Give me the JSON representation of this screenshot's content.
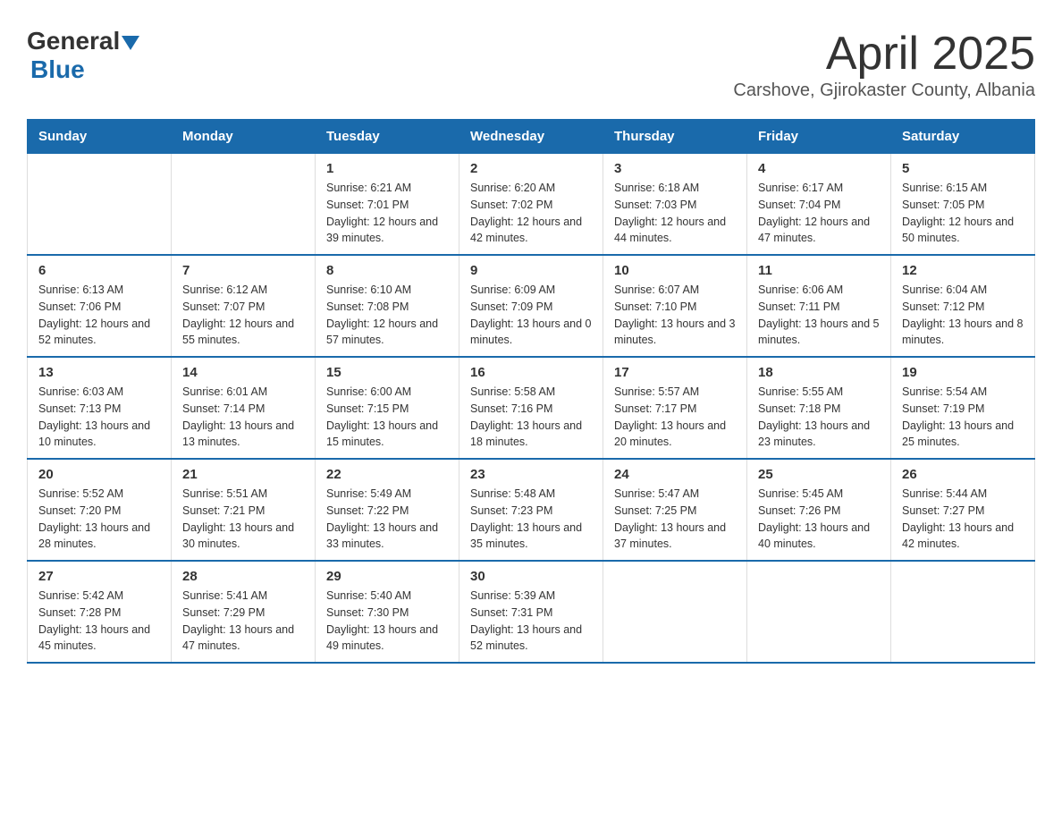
{
  "logo": {
    "general": "General",
    "blue": "Blue"
  },
  "title": "April 2025",
  "subtitle": "Carshove, Gjirokaster County, Albania",
  "days_of_week": [
    "Sunday",
    "Monday",
    "Tuesday",
    "Wednesday",
    "Thursday",
    "Friday",
    "Saturday"
  ],
  "weeks": [
    [
      {
        "day": "",
        "sunrise": "",
        "sunset": "",
        "daylight": ""
      },
      {
        "day": "",
        "sunrise": "",
        "sunset": "",
        "daylight": ""
      },
      {
        "day": "1",
        "sunrise": "Sunrise: 6:21 AM",
        "sunset": "Sunset: 7:01 PM",
        "daylight": "Daylight: 12 hours and 39 minutes."
      },
      {
        "day": "2",
        "sunrise": "Sunrise: 6:20 AM",
        "sunset": "Sunset: 7:02 PM",
        "daylight": "Daylight: 12 hours and 42 minutes."
      },
      {
        "day": "3",
        "sunrise": "Sunrise: 6:18 AM",
        "sunset": "Sunset: 7:03 PM",
        "daylight": "Daylight: 12 hours and 44 minutes."
      },
      {
        "day": "4",
        "sunrise": "Sunrise: 6:17 AM",
        "sunset": "Sunset: 7:04 PM",
        "daylight": "Daylight: 12 hours and 47 minutes."
      },
      {
        "day": "5",
        "sunrise": "Sunrise: 6:15 AM",
        "sunset": "Sunset: 7:05 PM",
        "daylight": "Daylight: 12 hours and 50 minutes."
      }
    ],
    [
      {
        "day": "6",
        "sunrise": "Sunrise: 6:13 AM",
        "sunset": "Sunset: 7:06 PM",
        "daylight": "Daylight: 12 hours and 52 minutes."
      },
      {
        "day": "7",
        "sunrise": "Sunrise: 6:12 AM",
        "sunset": "Sunset: 7:07 PM",
        "daylight": "Daylight: 12 hours and 55 minutes."
      },
      {
        "day": "8",
        "sunrise": "Sunrise: 6:10 AM",
        "sunset": "Sunset: 7:08 PM",
        "daylight": "Daylight: 12 hours and 57 minutes."
      },
      {
        "day": "9",
        "sunrise": "Sunrise: 6:09 AM",
        "sunset": "Sunset: 7:09 PM",
        "daylight": "Daylight: 13 hours and 0 minutes."
      },
      {
        "day": "10",
        "sunrise": "Sunrise: 6:07 AM",
        "sunset": "Sunset: 7:10 PM",
        "daylight": "Daylight: 13 hours and 3 minutes."
      },
      {
        "day": "11",
        "sunrise": "Sunrise: 6:06 AM",
        "sunset": "Sunset: 7:11 PM",
        "daylight": "Daylight: 13 hours and 5 minutes."
      },
      {
        "day": "12",
        "sunrise": "Sunrise: 6:04 AM",
        "sunset": "Sunset: 7:12 PM",
        "daylight": "Daylight: 13 hours and 8 minutes."
      }
    ],
    [
      {
        "day": "13",
        "sunrise": "Sunrise: 6:03 AM",
        "sunset": "Sunset: 7:13 PM",
        "daylight": "Daylight: 13 hours and 10 minutes."
      },
      {
        "day": "14",
        "sunrise": "Sunrise: 6:01 AM",
        "sunset": "Sunset: 7:14 PM",
        "daylight": "Daylight: 13 hours and 13 minutes."
      },
      {
        "day": "15",
        "sunrise": "Sunrise: 6:00 AM",
        "sunset": "Sunset: 7:15 PM",
        "daylight": "Daylight: 13 hours and 15 minutes."
      },
      {
        "day": "16",
        "sunrise": "Sunrise: 5:58 AM",
        "sunset": "Sunset: 7:16 PM",
        "daylight": "Daylight: 13 hours and 18 minutes."
      },
      {
        "day": "17",
        "sunrise": "Sunrise: 5:57 AM",
        "sunset": "Sunset: 7:17 PM",
        "daylight": "Daylight: 13 hours and 20 minutes."
      },
      {
        "day": "18",
        "sunrise": "Sunrise: 5:55 AM",
        "sunset": "Sunset: 7:18 PM",
        "daylight": "Daylight: 13 hours and 23 minutes."
      },
      {
        "day": "19",
        "sunrise": "Sunrise: 5:54 AM",
        "sunset": "Sunset: 7:19 PM",
        "daylight": "Daylight: 13 hours and 25 minutes."
      }
    ],
    [
      {
        "day": "20",
        "sunrise": "Sunrise: 5:52 AM",
        "sunset": "Sunset: 7:20 PM",
        "daylight": "Daylight: 13 hours and 28 minutes."
      },
      {
        "day": "21",
        "sunrise": "Sunrise: 5:51 AM",
        "sunset": "Sunset: 7:21 PM",
        "daylight": "Daylight: 13 hours and 30 minutes."
      },
      {
        "day": "22",
        "sunrise": "Sunrise: 5:49 AM",
        "sunset": "Sunset: 7:22 PM",
        "daylight": "Daylight: 13 hours and 33 minutes."
      },
      {
        "day": "23",
        "sunrise": "Sunrise: 5:48 AM",
        "sunset": "Sunset: 7:23 PM",
        "daylight": "Daylight: 13 hours and 35 minutes."
      },
      {
        "day": "24",
        "sunrise": "Sunrise: 5:47 AM",
        "sunset": "Sunset: 7:25 PM",
        "daylight": "Daylight: 13 hours and 37 minutes."
      },
      {
        "day": "25",
        "sunrise": "Sunrise: 5:45 AM",
        "sunset": "Sunset: 7:26 PM",
        "daylight": "Daylight: 13 hours and 40 minutes."
      },
      {
        "day": "26",
        "sunrise": "Sunrise: 5:44 AM",
        "sunset": "Sunset: 7:27 PM",
        "daylight": "Daylight: 13 hours and 42 minutes."
      }
    ],
    [
      {
        "day": "27",
        "sunrise": "Sunrise: 5:42 AM",
        "sunset": "Sunset: 7:28 PM",
        "daylight": "Daylight: 13 hours and 45 minutes."
      },
      {
        "day": "28",
        "sunrise": "Sunrise: 5:41 AM",
        "sunset": "Sunset: 7:29 PM",
        "daylight": "Daylight: 13 hours and 47 minutes."
      },
      {
        "day": "29",
        "sunrise": "Sunrise: 5:40 AM",
        "sunset": "Sunset: 7:30 PM",
        "daylight": "Daylight: 13 hours and 49 minutes."
      },
      {
        "day": "30",
        "sunrise": "Sunrise: 5:39 AM",
        "sunset": "Sunset: 7:31 PM",
        "daylight": "Daylight: 13 hours and 52 minutes."
      },
      {
        "day": "",
        "sunrise": "",
        "sunset": "",
        "daylight": ""
      },
      {
        "day": "",
        "sunrise": "",
        "sunset": "",
        "daylight": ""
      },
      {
        "day": "",
        "sunrise": "",
        "sunset": "",
        "daylight": ""
      }
    ]
  ]
}
